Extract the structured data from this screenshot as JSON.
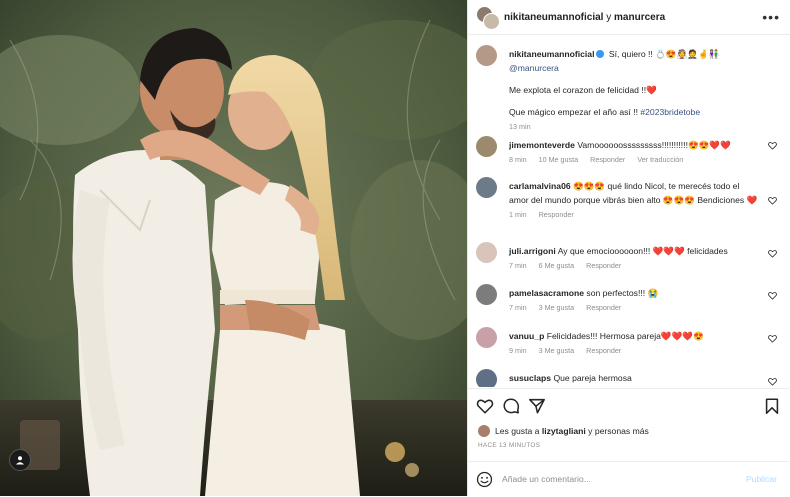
{
  "header": {
    "account": "nikitaneumannoficial",
    "connector": "y",
    "collaborator": "manurcera"
  },
  "caption": {
    "username": "nikitaneumannoficial",
    "line1_text": "Sí, quiero !!",
    "line1_emojis": "💍😍👰🤵🤞👫",
    "mention": "@manurcera",
    "line2": "Me explota el corazon de felicidad !!",
    "line2_emoji": "❤️",
    "line3": "Que mágico empezar el año así !!",
    "hashtag": "#2023bridetobe",
    "time": "13 min"
  },
  "comments": [
    {
      "username": "jimemonteverde",
      "text": "Vamoooooosssssssss!!!!!!!!!!!",
      "emojis": "😍😍",
      "hearts": "❤️❤️",
      "time": "8 min",
      "likes": "10 Me gusta",
      "reply": "Responder",
      "translate": "Ver traducción"
    },
    {
      "username": "carlamalvina06",
      "emojis_pre": "😍😍😍",
      "text": "qué lindo Nicol, te merecés todo el amor del mundo porque vibrás bien alto",
      "emojis_post": "😍😍😍",
      "text2": "Bendiciones",
      "hearts": "❤️",
      "time": "1 min",
      "reply": "Responder"
    },
    {
      "username": "juli.arrigoni",
      "text": "Ay que emocioooooon!!!",
      "hearts": "❤️❤️❤️",
      "text2": "felicidades",
      "time": "7 min",
      "likes": "6 Me gusta",
      "reply": "Responder"
    },
    {
      "username": "pamelasacramone",
      "text": "son perfectos!!!",
      "emojis": "😭",
      "time": "7 min",
      "likes": "3 Me gusta",
      "reply": "Responder"
    },
    {
      "username": "vanuu_p",
      "text": "Felicidades!!! Hermosa pareja",
      "hearts": "❤️❤️❤️",
      "emojis": "😍",
      "time": "9 min",
      "likes": "3 Me gusta",
      "reply": "Responder"
    },
    {
      "username": "susuclaps",
      "text": "Que pareja hermosa"
    }
  ],
  "likes_line": {
    "prefix": "Les gusta a",
    "user": "lizytagliani",
    "suffix": "y personas más"
  },
  "posted_ago": "HACE 13 MINUTOS",
  "composer": {
    "placeholder": "Añade un comentario...",
    "publish": "Publicar"
  },
  "colors": {
    "verified": "#3897f0",
    "heart": "#e0245e",
    "link": "#385185",
    "publish_disabled": "#b3dbff"
  },
  "icons": {
    "tag_user": "user-icon",
    "more": "more-options-icon",
    "like": "heart-icon",
    "comment": "comment-icon",
    "share": "paper-plane-icon",
    "save": "bookmark-icon",
    "emoji": "smiley-icon"
  }
}
